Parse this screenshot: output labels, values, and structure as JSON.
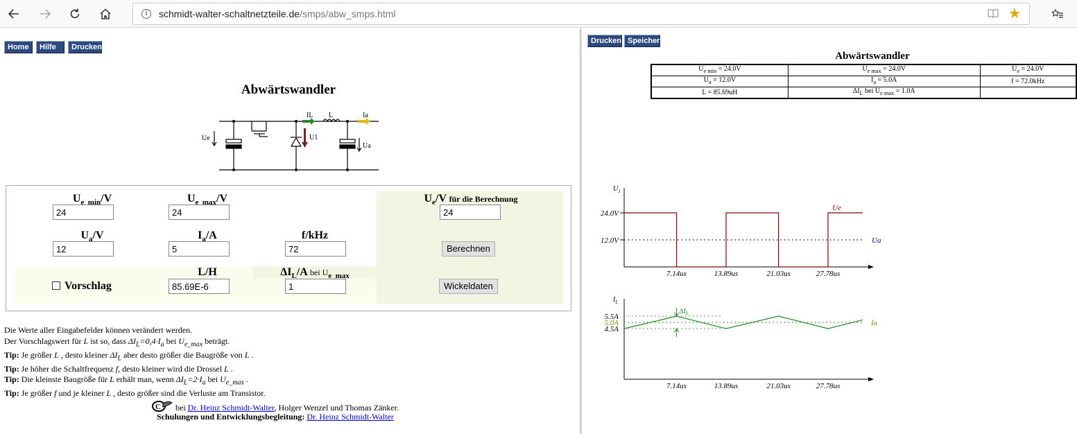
{
  "browser": {
    "url_host": "schmidt-walter-schaltnetzteile.de",
    "url_path": "/smps/abw_smps.html"
  },
  "left": {
    "nav": [
      "Home",
      "Hilfe",
      "Drucken"
    ],
    "title": "Abwärtswandler",
    "circuit_labels": {
      "ue": "Ue",
      "il": "IL",
      "l": "L",
      "ia": "Ia",
      "u1": "U1",
      "ua": "Ua"
    },
    "form": {
      "ue_min_label": "U",
      "ue_min_sub": "e_min",
      "ue_min_unit": "/V",
      "ue_min_value": "24",
      "ue_max_label": "U",
      "ue_max_sub": "e_max",
      "ue_max_unit": "/V",
      "ue_max_value": "24",
      "ue_calc_label": "U",
      "ue_calc_sub": "e",
      "ue_calc_unit": "/V",
      "ue_calc_small": "für die Berechnung",
      "ue_calc_value": "24",
      "ua_label": "U",
      "ua_sub": "a",
      "ua_unit": "/V",
      "ua_value": "12",
      "ia_label": "I",
      "ia_sub": "a",
      "ia_unit": "/A",
      "ia_value": "5",
      "f_label": "f/kHz",
      "f_value": "72",
      "berechnen": "Berechnen",
      "vorschlag": "Vorschlag",
      "l_label": "L/H",
      "l_value": "85.69E-6",
      "dil_label": "ΔI",
      "dil_sub": "L",
      "dil_unit": "/A",
      "dil_small": "bei U",
      "dil_small_sub": "e_max",
      "dil_value": "1",
      "wickeldaten": "Wickeldaten"
    },
    "notes": {
      "line1": "Die Werte aller Eingabefelder können verändert werden.",
      "line2a": "Der Vorschlagswert für ",
      "line2b": "L",
      "line2c": " ist so, dass ",
      "line2d": "ΔI",
      "line2e": "L",
      "line2f": "=0,4·I",
      "line2g": "a",
      "line2h": " bei ",
      "line2i": "U",
      "line2j": "e_max",
      "line2k": " beträgt.",
      "tip": "Tip:",
      "tip1a": " Je größer ",
      "tip1b": "L",
      "tip1c": " , desto kleiner ",
      "tip1d": "ΔI",
      "tip1e": "L",
      "tip1f": " aber desto größer die Baugröße von ",
      "tip1g": "L",
      "tip1h": " .",
      "tip2a": " Je höher die Schaltfrequenz ",
      "tip2b": "f",
      "tip2c": ", desto kleiner wird die Drossel ",
      "tip2d": "L",
      "tip2e": " .",
      "tip3a": " Die kleinste Baugröße für ",
      "tip3b": "L",
      "tip3c": " erhält man, wenn ",
      "tip3d": "ΔI",
      "tip3e": "L",
      "tip3f": "=2·I",
      "tip3g": "a",
      "tip3h": " bei ",
      "tip3i": "U",
      "tip3j": "e_max",
      "tip3k": " .",
      "tip4a": " Je größer ",
      "tip4b": "f",
      "tip4c": " und je kleiner ",
      "tip4d": "L",
      "tip4e": " , desto größer sind die Verluste am Transistor."
    },
    "footer": {
      "bei": " bei ",
      "author_link": "Dr. Heinz Schmidt-Walter",
      "coauthors": ", Holger Wenzel und Thomas Zänker.",
      "schulungen": "Schulungen und Entwicklungsbegleitung:",
      "schulungen_link": "Dr. Heinz Schmidt-Walter"
    }
  },
  "right": {
    "buttons": [
      "Drucken",
      "Speichern"
    ],
    "title": "Abwärtswandler",
    "table": [
      [
        {
          "main": "U",
          "sub": "e min",
          "rest": " = 24.0V"
        },
        {
          "main": "U",
          "sub": "e max",
          "rest": " = 24.0V"
        },
        {
          "main": "U",
          "sub": "e",
          "rest": " = 24.0V"
        }
      ],
      [
        {
          "main": "U",
          "sub": "a",
          "rest": " = 12.0V"
        },
        {
          "main": "I",
          "sub": "a",
          "rest": " = 5.0A"
        },
        {
          "main": "f = 72.0kHz",
          "sub": "",
          "rest": ""
        }
      ],
      [
        {
          "main": "L = 85.69uH",
          "sub": "",
          "rest": ""
        },
        {
          "main": "ΔI",
          "sub": "L",
          "rest": " bei U",
          "sub2": "e max",
          "rest2": " = 1.0A"
        },
        {
          "main": "",
          "sub": "",
          "rest": ""
        }
      ]
    ]
  },
  "chart_data": [
    {
      "type": "line",
      "title": "",
      "ylabel": "U",
      "ylabel_sub": "1",
      "y_ticks": [
        "24.0V",
        "12.0V"
      ],
      "x_ticks": [
        "7.14us",
        "13.89us",
        "21.03us",
        "27.78us"
      ],
      "series": [
        {
          "name": "Ue",
          "color": "#8b0000",
          "style": "solid",
          "points": [
            [
              0,
              24
            ],
            [
              7.14,
              24
            ],
            [
              7.14,
              0
            ],
            [
              13.89,
              0
            ],
            [
              13.89,
              24
            ],
            [
              21.03,
              24
            ],
            [
              21.03,
              0
            ],
            [
              27.78,
              0
            ],
            [
              27.78,
              24
            ],
            [
              32.5,
              24
            ]
          ]
        },
        {
          "name": "Ua",
          "color": "#00008b",
          "style": "dotted",
          "points": [
            [
              0,
              12
            ],
            [
              32.5,
              12
            ]
          ]
        }
      ],
      "xlim": [
        0,
        32.5
      ],
      "ylim": [
        0,
        24
      ]
    },
    {
      "type": "line",
      "title": "",
      "ylabel": "I",
      "ylabel_sub": "L",
      "y_ticks": [
        "5.5A",
        "5.0A",
        "4.5A"
      ],
      "x_ticks": [
        "7.14us",
        "13.89us",
        "21.03us",
        "27.78us"
      ],
      "annotation": "ΔI",
      "annotation_sub": "L",
      "series": [
        {
          "name": "Ia",
          "color": "#228b22",
          "style": "solid",
          "points": [
            [
              0,
              4.5
            ],
            [
              7.14,
              5.5
            ],
            [
              13.89,
              4.5
            ],
            [
              21.03,
              5.5
            ],
            [
              27.78,
              4.5
            ],
            [
              32.5,
              5.2
            ]
          ]
        },
        {
          "name": "",
          "color": "#228b22",
          "style": "dotted",
          "points": [
            [
              0,
              5.0
            ],
            [
              32.5,
              5.0
            ]
          ]
        }
      ],
      "xlim": [
        0,
        32.5
      ],
      "ylim": [
        4.5,
        5.5
      ]
    }
  ]
}
